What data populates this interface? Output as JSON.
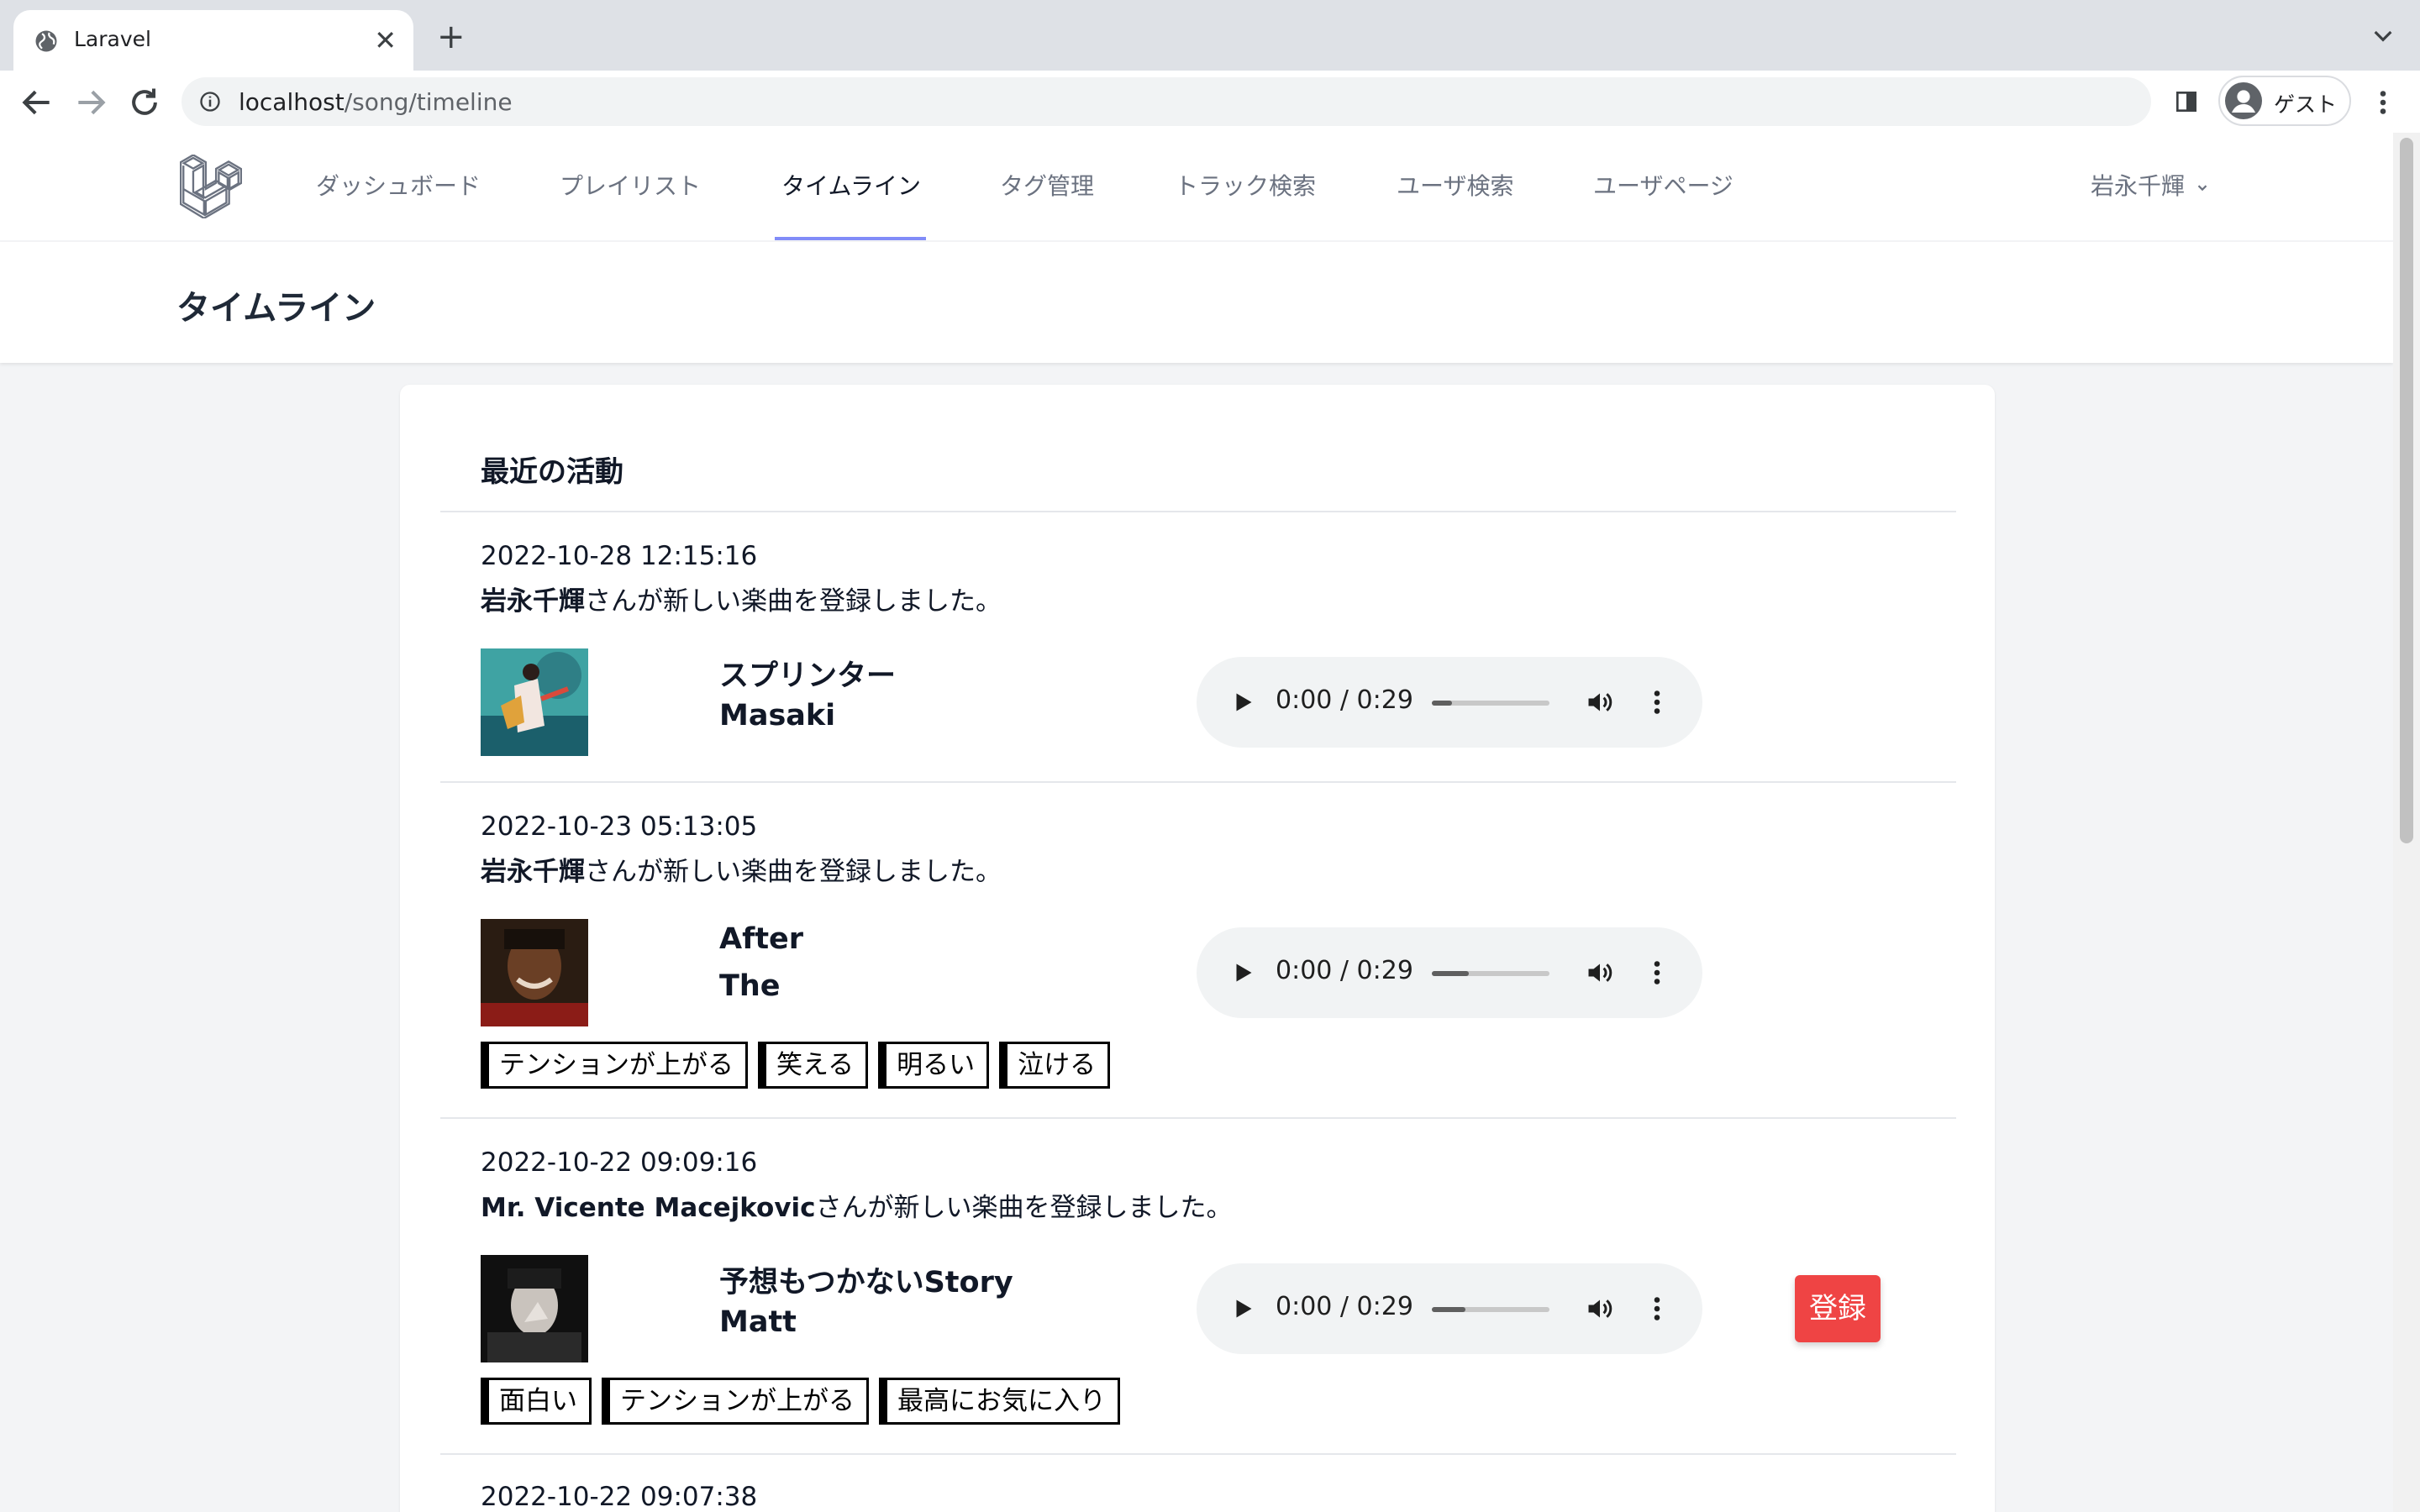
{
  "browser": {
    "tab_title": "Laravel",
    "tab_close": "✕",
    "new_tab": "+",
    "url_host": "localhost",
    "url_path": "/song/timeline",
    "profile_label": "ゲスト"
  },
  "nav": {
    "items": [
      {
        "label": "ダッシュボード",
        "active": false
      },
      {
        "label": "プレイリスト",
        "active": false
      },
      {
        "label": "タイムライン",
        "active": true
      },
      {
        "label": "タグ管理",
        "active": false
      },
      {
        "label": "トラック検索",
        "active": false
      },
      {
        "label": "ユーザ検索",
        "active": false
      },
      {
        "label": "ユーザページ",
        "active": false
      }
    ],
    "user_name": "岩永千輝"
  },
  "header": {
    "title": "タイムライン"
  },
  "card": {
    "heading": "最近の活動"
  },
  "entries": [
    {
      "date": "2022-10-28 12:15:16",
      "user": "岩永千輝",
      "action": "さんが新しい楽曲を登録しました。",
      "title": "スプリンター",
      "artist": "Masaki",
      "time": "0:00 / 0:29",
      "tags": []
    },
    {
      "date": "2022-10-23 05:13:05",
      "user": "岩永千輝",
      "action": "さんが新しい楽曲を登録しました。",
      "title": "After",
      "artist": "The",
      "time": "0:00 / 0:29",
      "tags": [
        "テンションが上がる",
        "笑える",
        "明るい",
        "泣ける"
      ]
    },
    {
      "date": "2022-10-22 09:09:16",
      "user": "Mr. Vicente Macejkovic",
      "action": "さんが新しい楽曲を登録しました。",
      "title": "予想もつかないStory",
      "artist": "Matt",
      "time": "0:00 / 0:29",
      "tags": [
        "面白い",
        "テンションが上がる",
        "最高にお気に入り"
      ],
      "register_label": "登録"
    },
    {
      "date": "2022-10-22 09:07:38"
    }
  ],
  "colors": {
    "accent_underline": "#818cf8",
    "register_button": "#ef4444",
    "page_bg": "#f3f4f6"
  },
  "icons": [
    "globe-favicon-icon",
    "close-icon",
    "plus-icon",
    "chevron-down-icon",
    "back-arrow-icon",
    "forward-arrow-icon",
    "reload-icon",
    "info-icon",
    "side-panel-icon",
    "profile-icon",
    "more-vert-icon",
    "laravel-logo-icon",
    "play-icon",
    "volume-icon"
  ]
}
